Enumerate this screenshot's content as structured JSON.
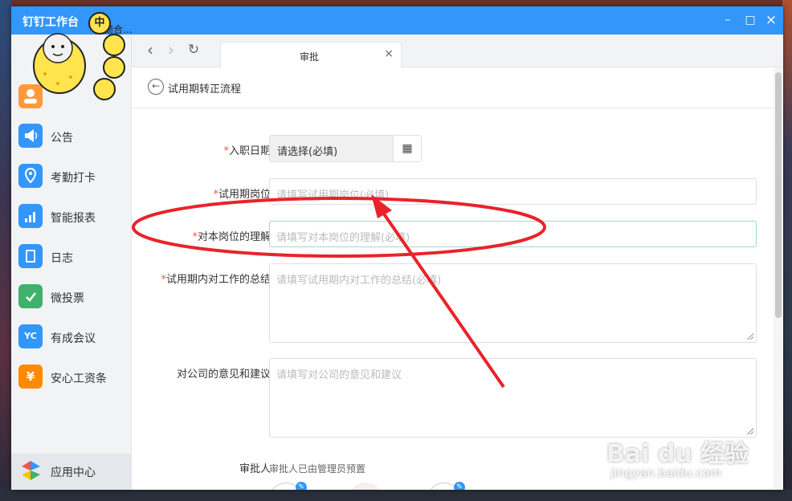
{
  "window": {
    "title": "钉钉工作台",
    "minimize": "–",
    "maximize": "□",
    "close": "×",
    "truncated_name": "德合…"
  },
  "stickers": {
    "zhong": "中"
  },
  "sidebar": {
    "items": [
      {
        "label": "公告",
        "icon": "megaphone-icon",
        "color": "#3296fa",
        "glyph": "📢"
      },
      {
        "label": "考勤打卡",
        "icon": "location-pin-icon",
        "color": "#3296fa",
        "glyph": "⌖"
      },
      {
        "label": "智能报表",
        "icon": "bar-chart-icon",
        "color": "#3296fa",
        "glyph": "▮"
      },
      {
        "label": "日志",
        "icon": "notebook-icon",
        "color": "#3296fa",
        "glyph": "✎"
      },
      {
        "label": "微投票",
        "icon": "vote-icon",
        "color": "#40b06b",
        "glyph": "✓"
      },
      {
        "label": "有成会议",
        "icon": "meeting-icon",
        "color": "#3296fa",
        "glyph": "YC"
      },
      {
        "label": "安心工资条",
        "icon": "payslip-icon",
        "color": "#ff8a00",
        "glyph": "¥"
      }
    ],
    "app_center": {
      "label": "应用中心",
      "icon": "app-center-icon"
    }
  },
  "toolbar": {
    "back": "‹",
    "forward": "›",
    "refresh": "↻",
    "tab_label": "审批",
    "tab_close": "×"
  },
  "form": {
    "header_title": "试用期转正流程",
    "required_mark": "*",
    "fields": {
      "entry_date": {
        "label": "入职日期",
        "placeholder": "请选择(必填)",
        "button": "▦"
      },
      "position": {
        "label": "试用期岗位",
        "placeholder": "请填写试用期岗位(必填)"
      },
      "understanding": {
        "label": "对本岗位的理解",
        "placeholder": "请填写对本岗位的理解(必填)"
      },
      "summary": {
        "label": "试用期内对工作的总结",
        "placeholder": "请填写试用期内对工作的总结(必填)"
      },
      "suggestion": {
        "label": "对公司的意见和建议",
        "placeholder": "请填写对公司的意见和建议"
      }
    },
    "approver": {
      "label": "审批人",
      "note": "审批人已由管理员预置"
    }
  },
  "watermark": {
    "main": "Bai du 经验",
    "sub": "jingyan.baidu.com"
  },
  "colors": {
    "accent": "#3296fa",
    "required": "#f25643",
    "annotation": "#e8232a"
  }
}
